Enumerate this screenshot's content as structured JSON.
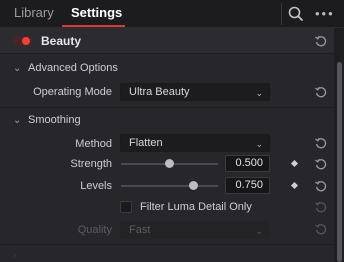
{
  "tabs": [
    {
      "label": "Library",
      "active": false
    },
    {
      "label": "Settings",
      "active": true
    }
  ],
  "toolbar": {
    "more_glyph": "•••"
  },
  "beauty": {
    "title": "Beauty",
    "enabled": true
  },
  "advanced_options": {
    "title": "Advanced Options",
    "operating_mode": {
      "label": "Operating Mode",
      "value": "Ultra Beauty"
    }
  },
  "smoothing": {
    "title": "Smoothing",
    "method": {
      "label": "Method",
      "value": "Flatten"
    },
    "strength": {
      "label": "Strength",
      "value": "0.500",
      "level": 0.5
    },
    "levels": {
      "label": "Levels",
      "value": "0.750",
      "level": 0.75
    },
    "filter_luma": {
      "label": "Filter Luma Detail Only",
      "checked": false
    },
    "quality": {
      "label": "Quality",
      "value": "Fast",
      "disabled": true
    }
  },
  "colors": {
    "accent_red": "#d33b3b",
    "toggle_on": "#e8443f",
    "panel_bg": "#27272b"
  },
  "icons": [
    "search-icon",
    "more-icon",
    "reset-icon",
    "chevron-down-icon",
    "keyframe-diamond-icon"
  ]
}
